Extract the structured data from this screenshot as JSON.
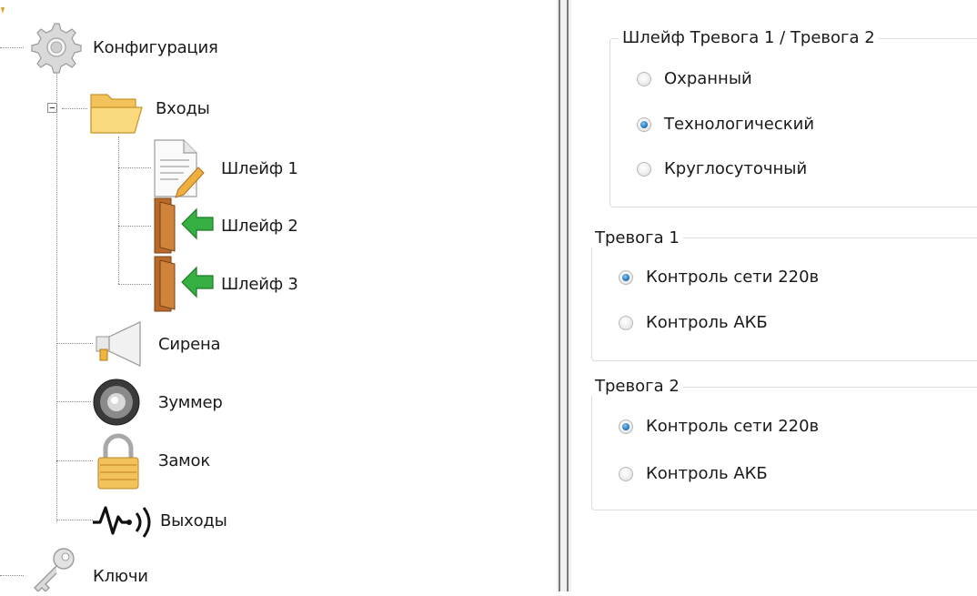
{
  "tree": {
    "root": {
      "label": "Конфигурация",
      "icon": "gear-icon"
    },
    "inputs": {
      "label": "Входы",
      "icon": "folder-open-icon"
    },
    "loop1": {
      "label": "Шлейф 1",
      "icon": "document-edit-icon"
    },
    "loop2": {
      "label": "Шлейф 2",
      "icon": "door-arrow-icon"
    },
    "loop3": {
      "label": "Шлейф 3",
      "icon": "door-arrow-icon"
    },
    "siren": {
      "label": "Сирена",
      "icon": "megaphone-icon"
    },
    "buzzer": {
      "label": "Зуммер",
      "icon": "speaker-icon"
    },
    "lock": {
      "label": "Замок",
      "icon": "padlock-icon"
    },
    "outputs": {
      "label": "Выходы",
      "icon": "signal-wave-icon"
    },
    "keys": {
      "label": "Ключи",
      "icon": "key-icon"
    }
  },
  "groups": {
    "loop_mode": {
      "title": "Шлейф Тревога 1 / Тревога 2",
      "options": [
        {
          "label": "Охранный",
          "checked": false
        },
        {
          "label": "Технологический",
          "checked": true
        },
        {
          "label": "Круглосуточный",
          "checked": false
        }
      ]
    },
    "alarm1": {
      "title": "Тревога 1",
      "options": [
        {
          "label": "Контроль сети 220в",
          "checked": true
        },
        {
          "label": "Контроль АКБ",
          "checked": false
        }
      ]
    },
    "alarm2": {
      "title": "Тревога 2",
      "options": [
        {
          "label": "Контроль сети 220в",
          "checked": true
        },
        {
          "label": "Контроль АКБ",
          "checked": false
        }
      ]
    }
  },
  "colors": {
    "accent": "#2a7fbf",
    "splitter": "#7a7a7a",
    "group_border": "#dcdcdc"
  }
}
